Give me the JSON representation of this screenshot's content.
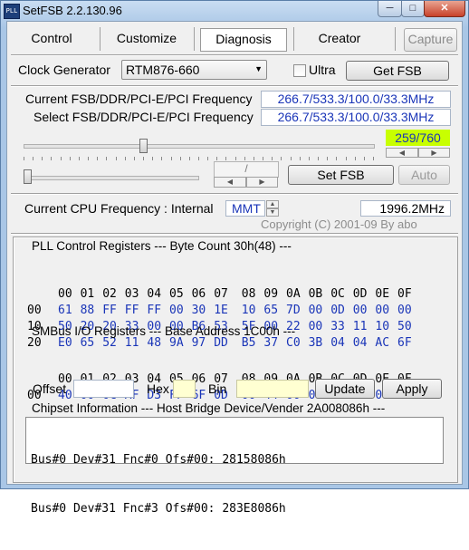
{
  "window": {
    "title": "SetFSB 2.2.130.96",
    "app_icon_text": "PLL"
  },
  "tabs": [
    {
      "label": "Control"
    },
    {
      "label": "Customize"
    },
    {
      "label": "Diagnosis",
      "active": true
    },
    {
      "label": "Creator"
    }
  ],
  "capture_label": "Capture",
  "clock": {
    "label": "Clock Generator",
    "selected": "RTM876-660",
    "ultra_label": "Ultra",
    "ultra_checked": false,
    "get_fsb_label": "Get FSB"
  },
  "freq": {
    "current_label": "Current FSB/DDR/PCI-E/PCI Frequency",
    "current_value": "266.7/533.3/100.0/33.3MHz",
    "select_label": "Select FSB/DDR/PCI-E/PCI Frequency",
    "select_value": "266.7/533.3/100.0/33.3MHz"
  },
  "slider": {
    "position": 259,
    "max": 760,
    "readout": "259/760"
  },
  "slider2": {
    "readout": "/"
  },
  "set_fsb_label": "Set FSB",
  "auto_label": "Auto",
  "cpu": {
    "label": "Current CPU Frequency : Internal",
    "source": "MMT",
    "value": "1996.2MHz"
  },
  "copyright": "Copyright (C) 2001-09 By abo",
  "pll": {
    "title": "PLL Control Registers  --- Byte Count 30h(48) ---",
    "header": [
      "00",
      "01",
      "02",
      "03",
      "04",
      "05",
      "06",
      "07",
      "08",
      "09",
      "0A",
      "0B",
      "0C",
      "0D",
      "0E",
      "0F"
    ],
    "rows": [
      {
        "label": "00",
        "bytes": [
          "61",
          "88",
          "FF",
          "FF",
          "FF",
          "00",
          "30",
          "1E",
          "10",
          "65",
          "7D",
          "00",
          "0D",
          "00",
          "00",
          "00"
        ]
      },
      {
        "label": "10",
        "bytes": [
          "50",
          "20",
          "20",
          "33",
          "00",
          "00",
          "B6",
          "53",
          "5F",
          "00",
          "22",
          "00",
          "33",
          "11",
          "10",
          "50"
        ]
      },
      {
        "label": "20",
        "bytes": [
          "E0",
          "65",
          "52",
          "11",
          "48",
          "9A",
          "97",
          "DD",
          "B5",
          "37",
          "C0",
          "3B",
          "04",
          "04",
          "AC",
          "6F"
        ]
      }
    ]
  },
  "smbus": {
    "title": "SMBus I/O Registers  --- Base Address 1C00h ---",
    "header": [
      "00",
      "01",
      "02",
      "03",
      "04",
      "05",
      "06",
      "07",
      "08",
      "09",
      "0A",
      "0B",
      "0C",
      "0D",
      "0E",
      "0F"
    ],
    "rows": [
      {
        "label": "00",
        "bytes": [
          "40",
          "00",
          "0C",
          "AF",
          "D3",
          "FF",
          "6F",
          "0D",
          "00",
          "44",
          "00",
          "00",
          "02",
          "00",
          "07",
          "07"
        ]
      }
    ]
  },
  "inputs": {
    "offset_label": "Offset",
    "offset_value": "",
    "hex_label": "Hex",
    "hex_value": "",
    "bin_label": "Bin",
    "bin_value": "",
    "update_label": "Update",
    "apply_label": "Apply"
  },
  "chipset": {
    "title": "Chipset Information  --- Host Bridge Device/Vender 2A008086h ---",
    "lines": [
      "Bus#0 Dev#31 Fnc#0 Ofs#00: 28158086h",
      "Bus#0 Dev#31 Fnc#3 Ofs#00: 283E8086h"
    ]
  },
  "colors": {
    "value_text": "#1a35b8",
    "readout_bg": "#c8ff00",
    "input_bg_yellow": "#ffffd2"
  },
  "icons": [
    "minimize-icon",
    "maximize-icon",
    "close-icon",
    "dropdown-arrow-icon",
    "spin-up-icon",
    "spin-down-icon"
  ]
}
